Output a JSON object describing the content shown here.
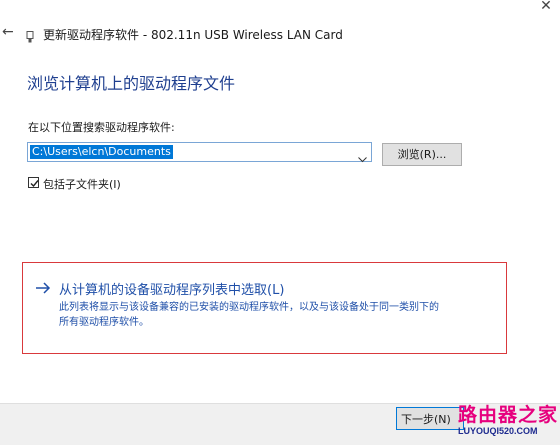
{
  "window": {
    "close_glyph": "✕",
    "back_glyph": "←",
    "title": "更新驱动程序软件 - 802.11n USB Wireless LAN Card"
  },
  "main": {
    "heading": "浏览计算机上的驱动程序文件",
    "location_label": "在以下位置搜索驱动程序软件:",
    "path_value": "C:\\Users\\elcn\\Documents",
    "browse_label": "浏览(R)...",
    "include_subfolders_label": "包括子文件夹(I)",
    "include_subfolders_checked": true
  },
  "pick_option": {
    "arrow_glyph": "→",
    "title": "从计算机的设备驱动程序列表中选取(L)",
    "desc_line1": "此列表将显示与该设备兼容的已安装的驱动程序软件，以及与该设备处于同一类别下的",
    "desc_line2": "所有驱动程序软件。",
    "highlight_color": "#d9393c"
  },
  "footer": {
    "next_label": "下一步(N)"
  },
  "watermark": {
    "top": "路由器之家",
    "bottom": "LUYOUQI520.COM"
  },
  "colors": {
    "accent": "#0078d7",
    "heading": "#1f3f8f",
    "link": "#1f4fa8"
  }
}
